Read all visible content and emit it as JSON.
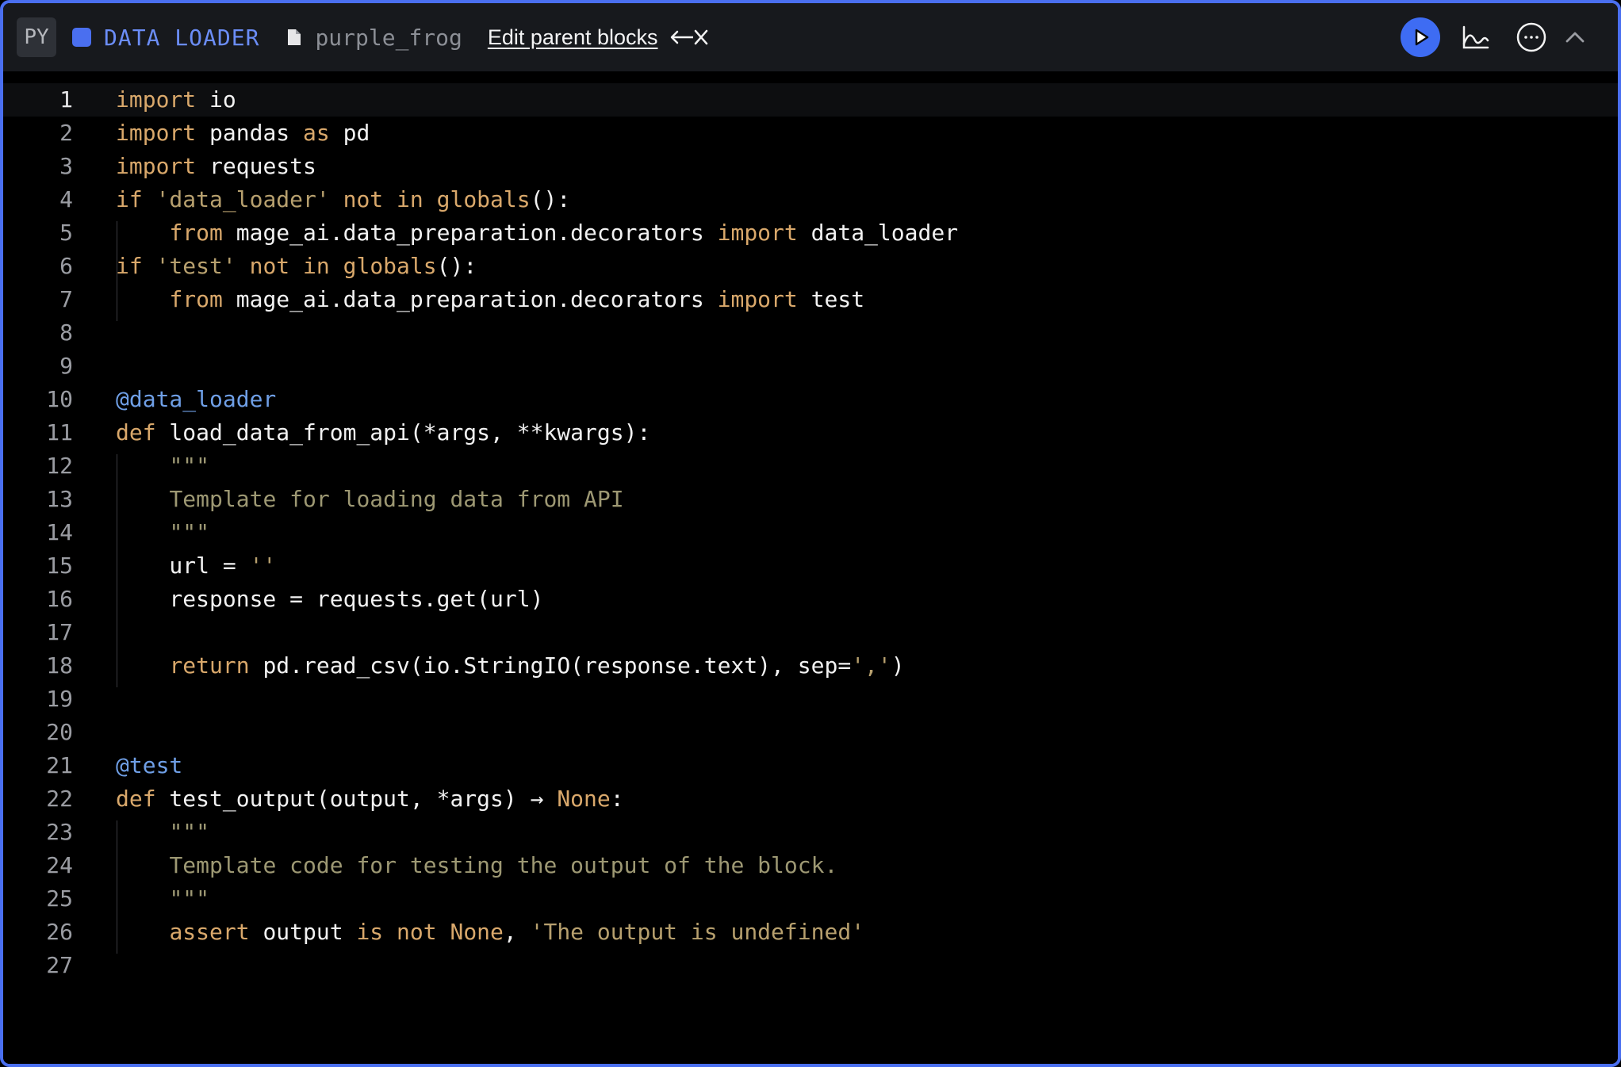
{
  "header": {
    "language": "PY",
    "block_type": "DATA LOADER",
    "block_name": "purple_frog",
    "edit_parents_label": "Edit parent blocks",
    "accent_color": "#4a6ff0"
  },
  "icons": {
    "type_dot": "square-dot-icon",
    "file": "file-icon",
    "edit_arrows": "arrow-left-close-icon",
    "run": "play-icon",
    "chart": "chart-icon",
    "more": "more-horizontal-icon",
    "collapse": "chevron-up-icon"
  },
  "editor": {
    "active_line": 1,
    "lines": [
      [
        [
          "kw",
          "import"
        ],
        [
          "txt",
          " io"
        ]
      ],
      [
        [
          "kw",
          "import"
        ],
        [
          "txt",
          " pandas "
        ],
        [
          "kw",
          "as"
        ],
        [
          "txt",
          " pd"
        ]
      ],
      [
        [
          "kw",
          "import"
        ],
        [
          "txt",
          " requests"
        ]
      ],
      [
        [
          "kw",
          "if"
        ],
        [
          "txt",
          " "
        ],
        [
          "str",
          "'data_loader'"
        ],
        [
          "txt",
          " "
        ],
        [
          "kw",
          "not in"
        ],
        [
          "txt",
          " "
        ],
        [
          "fn",
          "globals"
        ],
        [
          "txt",
          "():"
        ]
      ],
      [
        [
          "txt",
          "    "
        ],
        [
          "kw",
          "from"
        ],
        [
          "txt",
          " mage_ai.data_preparation.decorators "
        ],
        [
          "kw",
          "import"
        ],
        [
          "txt",
          " data_loader"
        ]
      ],
      [
        [
          "kw",
          "if"
        ],
        [
          "txt",
          " "
        ],
        [
          "str",
          "'test'"
        ],
        [
          "txt",
          " "
        ],
        [
          "kw",
          "not in"
        ],
        [
          "txt",
          " "
        ],
        [
          "fn",
          "globals"
        ],
        [
          "txt",
          "():"
        ]
      ],
      [
        [
          "txt",
          "    "
        ],
        [
          "kw",
          "from"
        ],
        [
          "txt",
          " mage_ai.data_preparation.decorators "
        ],
        [
          "kw",
          "import"
        ],
        [
          "txt",
          " test"
        ]
      ],
      [],
      [],
      [
        [
          "dec",
          "@data_loader"
        ]
      ],
      [
        [
          "kw",
          "def"
        ],
        [
          "txt",
          " load_data_from_api(*args, **kwargs):"
        ]
      ],
      [
        [
          "txt",
          "    "
        ],
        [
          "doc",
          "\"\"\""
        ]
      ],
      [
        [
          "txt",
          "    "
        ],
        [
          "doc",
          "Template for loading data from API"
        ]
      ],
      [
        [
          "txt",
          "    "
        ],
        [
          "doc",
          "\"\"\""
        ]
      ],
      [
        [
          "txt",
          "    url = "
        ],
        [
          "str",
          "''"
        ]
      ],
      [
        [
          "txt",
          "    response = requests.get(url)"
        ]
      ],
      [],
      [
        [
          "txt",
          "    "
        ],
        [
          "kw",
          "return"
        ],
        [
          "txt",
          " pd.read_csv(io.StringIO(response.text), sep="
        ],
        [
          "str",
          "','"
        ],
        [
          "txt",
          ")"
        ]
      ],
      [],
      [],
      [
        [
          "dec",
          "@test"
        ]
      ],
      [
        [
          "kw",
          "def"
        ],
        [
          "txt",
          " test_output(output, *args) → "
        ],
        [
          "kw",
          "None"
        ],
        [
          "txt",
          ":"
        ]
      ],
      [
        [
          "txt",
          "    "
        ],
        [
          "doc",
          "\"\"\""
        ]
      ],
      [
        [
          "txt",
          "    "
        ],
        [
          "doc",
          "Template code for testing the output of the block."
        ]
      ],
      [
        [
          "txt",
          "    "
        ],
        [
          "doc",
          "\"\"\""
        ]
      ],
      [
        [
          "txt",
          "    "
        ],
        [
          "kw",
          "assert"
        ],
        [
          "txt",
          " output "
        ],
        [
          "kw",
          "is not None"
        ],
        [
          "txt",
          ", "
        ],
        [
          "str",
          "'The output is undefined'"
        ]
      ],
      []
    ]
  }
}
